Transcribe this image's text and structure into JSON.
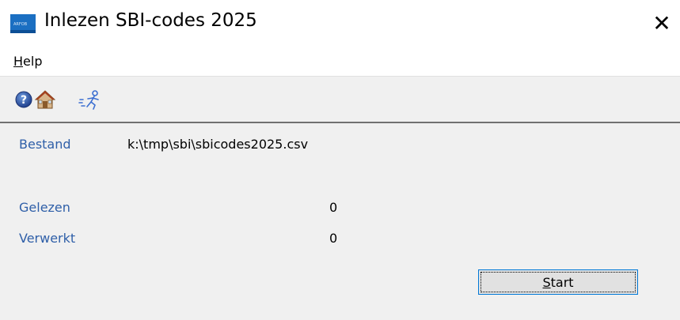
{
  "window": {
    "title": "Inlezen SBI-codes 2025",
    "icon_text": "ARFOB",
    "close_glyph": "✕"
  },
  "menu": {
    "help": {
      "mnemonic": "H",
      "rest": "elp"
    }
  },
  "toolbar": {
    "icons": [
      "help-icon",
      "home-icon",
      "person-run-icon"
    ]
  },
  "form": {
    "bestand_label": "Bestand",
    "bestand_value": "k:\\tmp\\sbi\\sbicodes2025.csv",
    "gelezen_label": "Gelezen",
    "gelezen_value": "0",
    "verwerkt_label": "Verwerkt",
    "verwerkt_value": "0"
  },
  "start_button": {
    "mnemonic": "S",
    "rest": "tart"
  },
  "colors": {
    "label": "#2f5fa8",
    "accent": "#0078d7",
    "background": "#f0f0f0"
  }
}
